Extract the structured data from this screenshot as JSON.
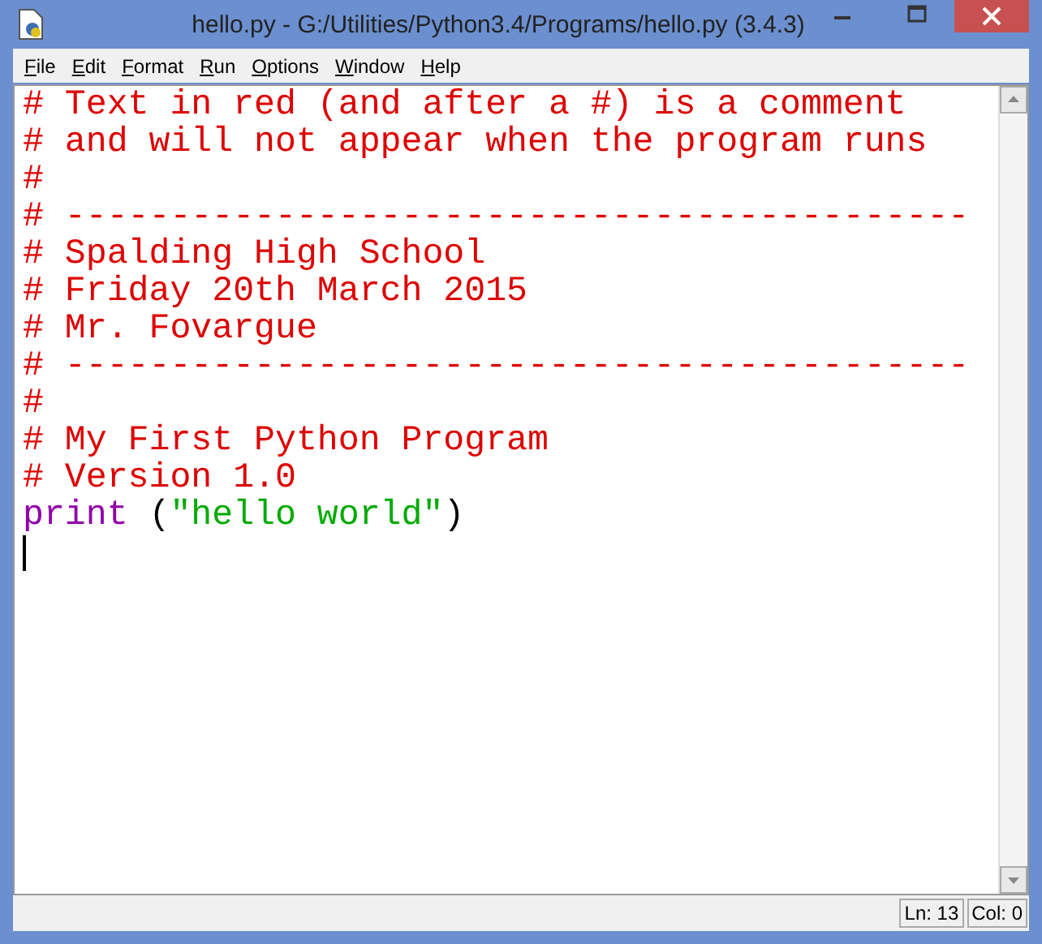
{
  "window": {
    "title": "hello.py - G:/Utilities/Python3.4/Programs/hello.py (3.4.3)"
  },
  "menu": [
    "File",
    "Edit",
    "Format",
    "Run",
    "Options",
    "Window",
    "Help"
  ],
  "editor": {
    "cursor": true,
    "lines": [
      [
        {
          "kind": "comment",
          "text": "# Text in red (and after a #) is a comment"
        }
      ],
      [
        {
          "kind": "comment",
          "text": "# and will not appear when the program runs"
        }
      ],
      [
        {
          "kind": "comment",
          "text": "#"
        }
      ],
      [
        {
          "kind": "comment",
          "text": "# -------------------------------------------"
        }
      ],
      [
        {
          "kind": "comment",
          "text": "# Spalding High School"
        }
      ],
      [
        {
          "kind": "comment",
          "text": "# Friday 20th March 2015"
        }
      ],
      [
        {
          "kind": "comment",
          "text": "# Mr. Fovargue"
        }
      ],
      [
        {
          "kind": "comment",
          "text": "# -------------------------------------------"
        }
      ],
      [
        {
          "kind": "comment",
          "text": "#"
        }
      ],
      [
        {
          "kind": "comment",
          "text": "# My First Python Program"
        }
      ],
      [
        {
          "kind": "comment",
          "text": "# Version 1.0"
        }
      ],
      [
        {
          "kind": "keyword",
          "text": "print"
        },
        {
          "kind": "plain",
          "text": " ("
        },
        {
          "kind": "string",
          "text": "\"hello world\""
        },
        {
          "kind": "plain",
          "text": ")"
        }
      ]
    ]
  },
  "status_bar": {
    "line": "Ln: 13",
    "column": "Col: 0"
  }
}
